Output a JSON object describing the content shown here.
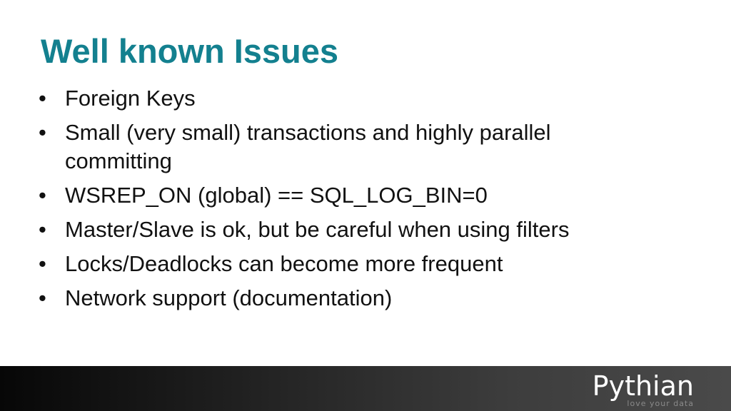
{
  "slide": {
    "title": "Well known Issues",
    "bullet_marker": "•",
    "bullets": [
      "Foreign Keys",
      "Small (very small) transactions and highly parallel committing",
      "WSREP_ON (global) == SQL_LOG_BIN=0",
      "Master/Slave is ok, but be careful when using filters",
      "Locks/Deadlocks can become more frequent",
      "Network support (documentation)"
    ]
  },
  "footer": {
    "logo_text": "Pythian",
    "tagline": "love your data",
    "title_color": "#13808f"
  }
}
